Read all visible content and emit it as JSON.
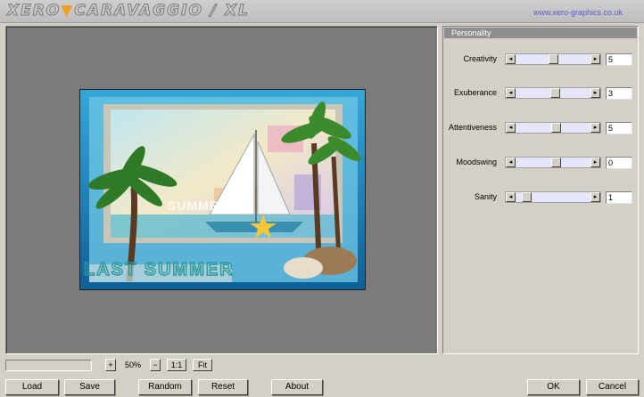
{
  "header": {
    "logo_part1": "XERO",
    "logo_separator": "▼",
    "logo_part2": "CARAVAGGIO / XL",
    "url": "www.xero-graphics.co.uk"
  },
  "preview": {
    "image_word_top": "SUMMER",
    "image_word_bottom": "LAST SUMMER"
  },
  "panel": {
    "title": "Personality",
    "params": [
      {
        "label": "Creativity",
        "value": "5",
        "level": 0.5
      },
      {
        "label": "Exuberance",
        "value": "3",
        "level": 0.53
      },
      {
        "label": "Attentiveness",
        "value": "5",
        "level": 0.55
      },
      {
        "label": "Moodswing",
        "value": "0",
        "level": 0.55
      },
      {
        "label": "Sanity",
        "value": "1",
        "level": 0.1
      }
    ]
  },
  "zoom": {
    "plus": "+",
    "level": "50%",
    "minus": "−",
    "one_to_one": "1:1",
    "fit": "Fit"
  },
  "buttons": {
    "load": "Load",
    "save": "Save",
    "random": "Random",
    "reset": "Reset",
    "about": "About",
    "ok": "OK",
    "cancel": "Cancel"
  },
  "icons": {
    "slider_left": "◂",
    "slider_right": "▸"
  }
}
